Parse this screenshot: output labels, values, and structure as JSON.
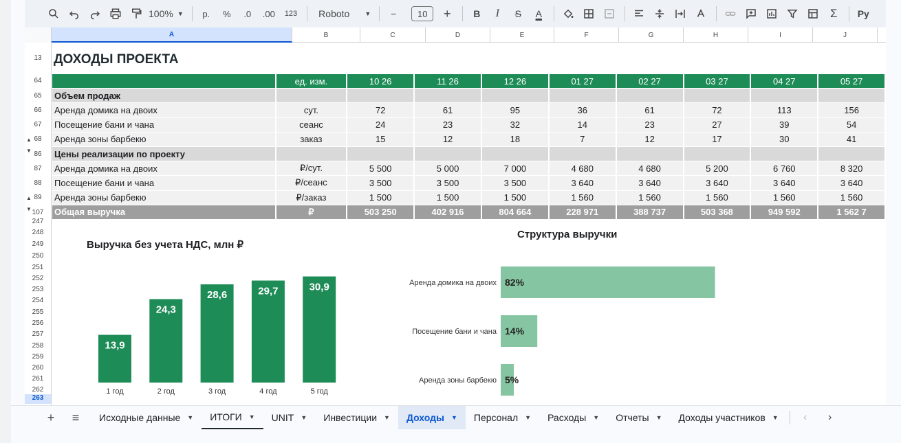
{
  "toolbar": {
    "zoom": "100%",
    "currency": "р.",
    "percent": "%",
    "dec_down": ".0",
    "dec_up": ".00",
    "number_format": "123",
    "font": "Roboto",
    "font_size": "10",
    "minus": "−",
    "plus": "+",
    "bold": "B",
    "italic": "I",
    "strike": "S",
    "text_color": "A",
    "sigma": "Σ",
    "input_tools": "Ру"
  },
  "columns": [
    "A",
    "B",
    "C",
    "D",
    "E",
    "F",
    "G",
    "H",
    "I",
    "J"
  ],
  "row_numbers": [
    "13",
    "64",
    "65",
    "66",
    "67",
    "68",
    "86",
    "87",
    "88",
    "89",
    "107",
    "247",
    "248",
    "249",
    "250",
    "251",
    "252",
    "253",
    "254",
    "255",
    "256",
    "257",
    "258",
    "259",
    "260",
    "261",
    "262",
    "263"
  ],
  "sheet": {
    "title": "ДОХОДЫ ПРОЕКТА",
    "header": {
      "unit": "ед. изм.",
      "months": [
        "10 26",
        "11 26",
        "12 26",
        "01 27",
        "02 27",
        "03 27",
        "04 27",
        "05 27"
      ]
    },
    "sections": [
      {
        "title": "Объем продаж",
        "rows": [
          {
            "label": "Аренда домика на двоих",
            "unit": "сут.",
            "values": [
              "72",
              "61",
              "95",
              "36",
              "61",
              "72",
              "113",
              "156"
            ]
          },
          {
            "label": "Посещение бани и чана",
            "unit": "сеанс",
            "values": [
              "24",
              "23",
              "32",
              "14",
              "23",
              "27",
              "39",
              "54"
            ]
          },
          {
            "label": "Аренда зоны барбекю",
            "unit": "заказ",
            "values": [
              "15",
              "12",
              "18",
              "7",
              "12",
              "17",
              "30",
              "41"
            ]
          }
        ]
      },
      {
        "title": "Цены реализации по проекту",
        "rows": [
          {
            "label": "Аренда домика на двоих",
            "unit": "₽/сут.",
            "values": [
              "5 500",
              "5 000",
              "7 000",
              "4 680",
              "4 680",
              "5 200",
              "6 760",
              "8 320"
            ]
          },
          {
            "label": "Посещение бани и чана",
            "unit": "₽/сеанс",
            "values": [
              "3 500",
              "3 500",
              "3 500",
              "3 640",
              "3 640",
              "3 640",
              "3 640",
              "3 640"
            ]
          },
          {
            "label": "Аренда зоны барбекю",
            "unit": "₽/заказ",
            "values": [
              "1 500",
              "1 500",
              "1 500",
              "1 560",
              "1 560",
              "1 560",
              "1 560",
              "1 560"
            ]
          }
        ]
      }
    ],
    "total": {
      "label": "Общая выручка",
      "unit": "₽",
      "values": [
        "503 250",
        "402 916",
        "804 664",
        "228 971",
        "388 737",
        "503 368",
        "949 592",
        "1 562 7"
      ]
    }
  },
  "chart_data": [
    {
      "type": "bar",
      "title": "Выручка без учета НДС, млн ₽",
      "categories": [
        "1 год",
        "2 год",
        "3 год",
        "4 год",
        "5 год"
      ],
      "values": [
        13.9,
        24.3,
        28.6,
        29.7,
        30.9
      ],
      "value_labels": [
        "13,9",
        "24,3",
        "28,6",
        "29,7",
        "30,9"
      ],
      "ylim": [
        0,
        32
      ],
      "color": "#1e8c57"
    },
    {
      "type": "bar",
      "orientation": "horizontal",
      "title": "Структура выручки",
      "categories": [
        "Аренда домика на двоих",
        "Посещение бани и чана",
        "Аренда зоны барбекю"
      ],
      "values": [
        82,
        14,
        5
      ],
      "value_labels": [
        "82%",
        "14%",
        "5%"
      ],
      "xlim": [
        0,
        100
      ],
      "color": "#86c5a2"
    }
  ],
  "tabs": [
    {
      "label": "Исходные данные",
      "active": false,
      "underline": false
    },
    {
      "label": "ИТОГИ",
      "active": false,
      "underline": true
    },
    {
      "label": "UNIT",
      "active": false,
      "underline": false
    },
    {
      "label": "Инвестиции",
      "active": false,
      "underline": false
    },
    {
      "label": "Доходы",
      "active": true,
      "underline": false
    },
    {
      "label": "Персонал",
      "active": false,
      "underline": false
    },
    {
      "label": "Расходы",
      "active": false,
      "underline": false
    },
    {
      "label": "Отчеты",
      "active": false,
      "underline": false
    },
    {
      "label": "Доходы участников",
      "active": false,
      "underline": false
    }
  ]
}
